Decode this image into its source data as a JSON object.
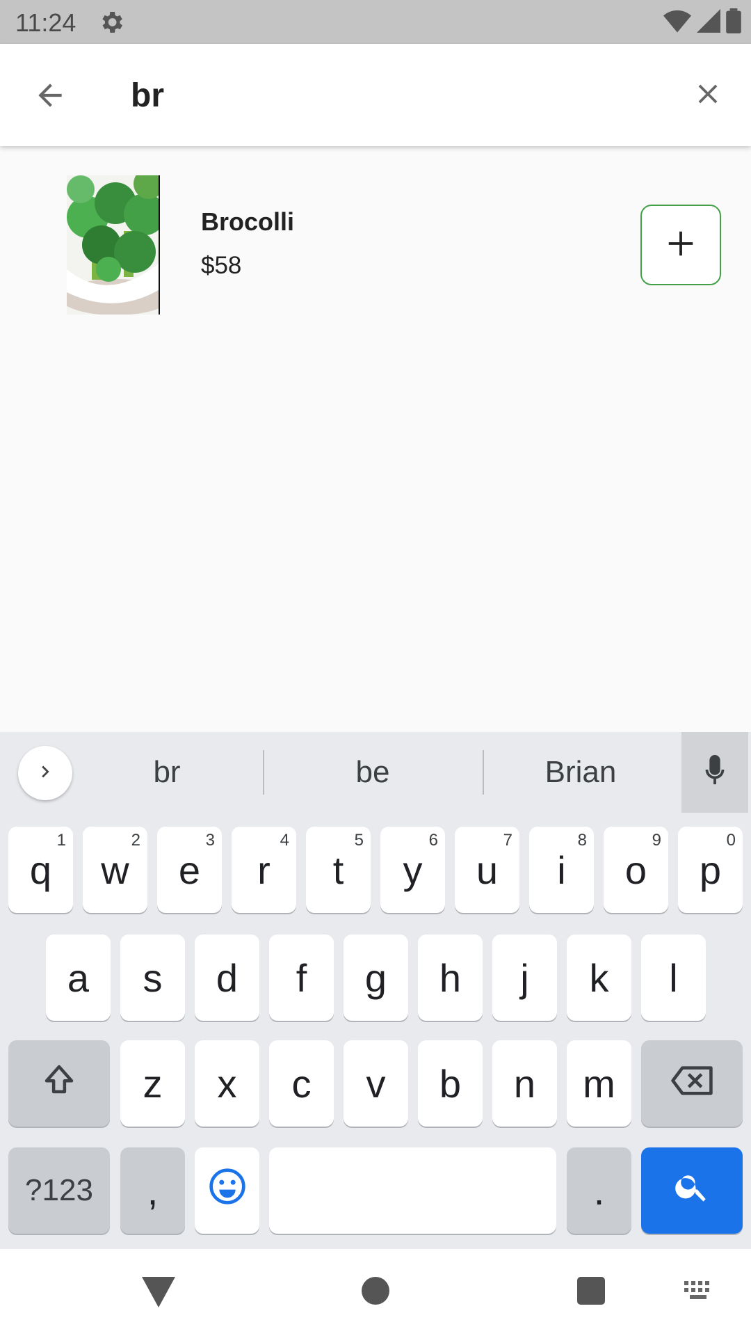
{
  "status_bar": {
    "time": "11:24",
    "icons": [
      "settings-icon",
      "wifi-icon",
      "signal-icon",
      "battery-icon"
    ]
  },
  "search": {
    "value": "br",
    "back_icon": "arrow-back-icon",
    "clear_icon": "close-icon"
  },
  "results": [
    {
      "name": "Brocolli",
      "price": "$58",
      "image": "broccoli-image",
      "add_icon": "plus-icon"
    }
  ],
  "colors": {
    "accent_green": "#43a047",
    "keyboard_bg": "#e8eaed",
    "search_key": "#1a73e8"
  },
  "keyboard": {
    "suggestions": [
      "br",
      "be",
      "Brian"
    ],
    "row1": [
      {
        "key": "q",
        "hint": "1"
      },
      {
        "key": "w",
        "hint": "2"
      },
      {
        "key": "e",
        "hint": "3"
      },
      {
        "key": "r",
        "hint": "4"
      },
      {
        "key": "t",
        "hint": "5"
      },
      {
        "key": "y",
        "hint": "6"
      },
      {
        "key": "u",
        "hint": "7"
      },
      {
        "key": "i",
        "hint": "8"
      },
      {
        "key": "o",
        "hint": "9"
      },
      {
        "key": "p",
        "hint": "0"
      }
    ],
    "row2": [
      "a",
      "s",
      "d",
      "f",
      "g",
      "h",
      "j",
      "k",
      "l"
    ],
    "row3": [
      "z",
      "x",
      "c",
      "v",
      "b",
      "n",
      "m"
    ],
    "symbols_label": "?123",
    "comma_label": ",",
    "period_label": "."
  },
  "nav_bar": {
    "icons": [
      "nav-back-icon",
      "nav-home-icon",
      "nav-recents-icon",
      "keyboard-switch-icon"
    ]
  }
}
